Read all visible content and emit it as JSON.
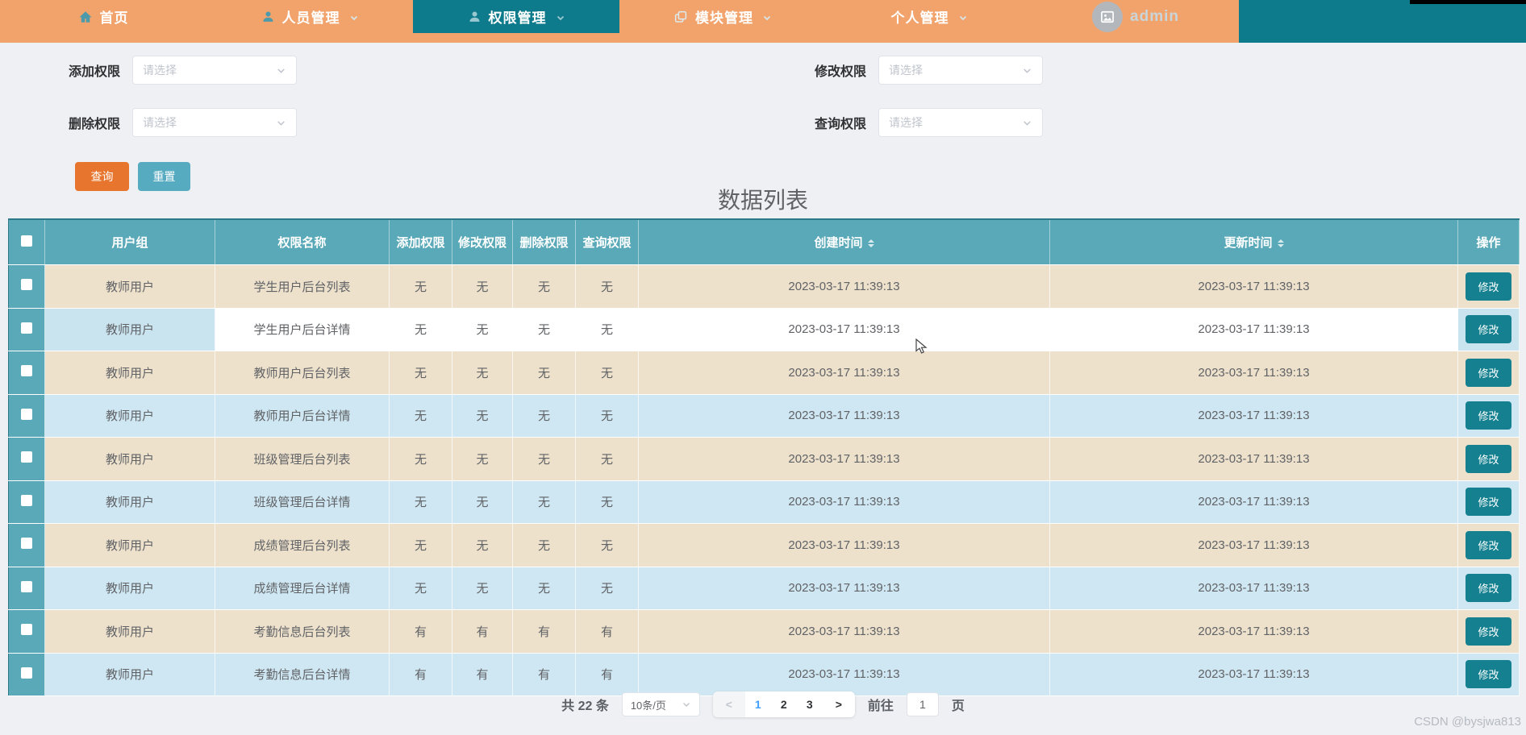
{
  "navbar": {
    "items": [
      {
        "key": "home",
        "label": "首页",
        "icon": "home-icon",
        "active": false,
        "arrow": false,
        "is_user": false
      },
      {
        "key": "personnel",
        "label": "人员管理",
        "icon": "user-icon",
        "active": false,
        "arrow": true,
        "is_user": false
      },
      {
        "key": "permissions",
        "label": "权限管理",
        "icon": "user-icon",
        "active": true,
        "arrow": true,
        "is_user": false
      },
      {
        "key": "modules",
        "label": "模块管理",
        "icon": "modules-icon",
        "active": false,
        "arrow": true,
        "is_user": false
      },
      {
        "key": "personal",
        "label": "个人管理",
        "icon": null,
        "active": false,
        "arrow": true,
        "is_user": false
      },
      {
        "key": "admin",
        "label": "admin",
        "icon": "avatar-image-icon",
        "active": false,
        "arrow": false,
        "is_user": true
      }
    ]
  },
  "filters": [
    {
      "label": "添加权限",
      "placeholder": "请选择"
    },
    {
      "label": "修改权限",
      "placeholder": "请选择"
    },
    {
      "label": "删除权限",
      "placeholder": "请选择"
    },
    {
      "label": "查询权限",
      "placeholder": "请选择"
    }
  ],
  "actions": {
    "search": "查询",
    "reset": "重置"
  },
  "list": {
    "title": "数据列表",
    "columns": [
      {
        "label": "用户组",
        "sortable": false
      },
      {
        "label": "权限名称",
        "sortable": false
      },
      {
        "label": "添加权限",
        "sortable": false
      },
      {
        "label": "修改权限",
        "sortable": false
      },
      {
        "label": "删除权限",
        "sortable": false
      },
      {
        "label": "查询权限",
        "sortable": false
      },
      {
        "label": "创建时间",
        "sortable": true
      },
      {
        "label": "更新时间",
        "sortable": true
      },
      {
        "label": "操作",
        "sortable": false
      }
    ],
    "action_label": "修改",
    "rows": [
      {
        "group": "教师用户",
        "name": "学生用户后台列表",
        "add": "无",
        "modify": "无",
        "del": "无",
        "query": "无",
        "created": "2023-03-17 11:39:13",
        "updated": "2023-03-17 11:39:13",
        "style": "beige"
      },
      {
        "group": "教师用户",
        "name": "学生用户后台详情",
        "add": "无",
        "modify": "无",
        "del": "无",
        "query": "无",
        "created": "2023-03-17 11:39:13",
        "updated": "2023-03-17 11:39:13",
        "style": "hover"
      },
      {
        "group": "教师用户",
        "name": "教师用户后台列表",
        "add": "无",
        "modify": "无",
        "del": "无",
        "query": "无",
        "created": "2023-03-17 11:39:13",
        "updated": "2023-03-17 11:39:13",
        "style": "beige"
      },
      {
        "group": "教师用户",
        "name": "教师用户后台详情",
        "add": "无",
        "modify": "无",
        "del": "无",
        "query": "无",
        "created": "2023-03-17 11:39:13",
        "updated": "2023-03-17 11:39:13",
        "style": "blue"
      },
      {
        "group": "教师用户",
        "name": "班级管理后台列表",
        "add": "无",
        "modify": "无",
        "del": "无",
        "query": "无",
        "created": "2023-03-17 11:39:13",
        "updated": "2023-03-17 11:39:13",
        "style": "beige"
      },
      {
        "group": "教师用户",
        "name": "班级管理后台详情",
        "add": "无",
        "modify": "无",
        "del": "无",
        "query": "无",
        "created": "2023-03-17 11:39:13",
        "updated": "2023-03-17 11:39:13",
        "style": "blue"
      },
      {
        "group": "教师用户",
        "name": "成绩管理后台列表",
        "add": "无",
        "modify": "无",
        "del": "无",
        "query": "无",
        "created": "2023-03-17 11:39:13",
        "updated": "2023-03-17 11:39:13",
        "style": "beige"
      },
      {
        "group": "教师用户",
        "name": "成绩管理后台详情",
        "add": "无",
        "modify": "无",
        "del": "无",
        "query": "无",
        "created": "2023-03-17 11:39:13",
        "updated": "2023-03-17 11:39:13",
        "style": "blue"
      },
      {
        "group": "教师用户",
        "name": "考勤信息后台列表",
        "add": "有",
        "modify": "有",
        "del": "有",
        "query": "有",
        "created": "2023-03-17 11:39:13",
        "updated": "2023-03-17 11:39:13",
        "style": "beige"
      },
      {
        "group": "教师用户",
        "name": "考勤信息后台详情",
        "add": "有",
        "modify": "有",
        "del": "有",
        "query": "有",
        "created": "2023-03-17 11:39:13",
        "updated": "2023-03-17 11:39:13",
        "style": "blue"
      }
    ]
  },
  "pagination": {
    "total_text": "共 22 条",
    "page_size": "10条/页",
    "prev_label": "<",
    "next_label": ">",
    "pages": [
      "1",
      "2",
      "3"
    ],
    "current_page": "1",
    "goto_label": "前往",
    "goto_value": "1",
    "goto_suffix": "页"
  },
  "watermark": "CSDN @bysjwa813",
  "colors": {
    "navbar_orange": "#f2a36c",
    "navbar_teal": "#0d7b8b",
    "table_header_teal": "#5aa9b8",
    "row_beige": "#ede1cc",
    "row_blue": "#cfe7f2",
    "row_hover_cell": "#c9e3ef",
    "search_button": "#e7752d",
    "reset_button": "#57abc0",
    "edit_button": "#15808f",
    "active_page": "#409eff",
    "page_background": "#eef0f4"
  }
}
